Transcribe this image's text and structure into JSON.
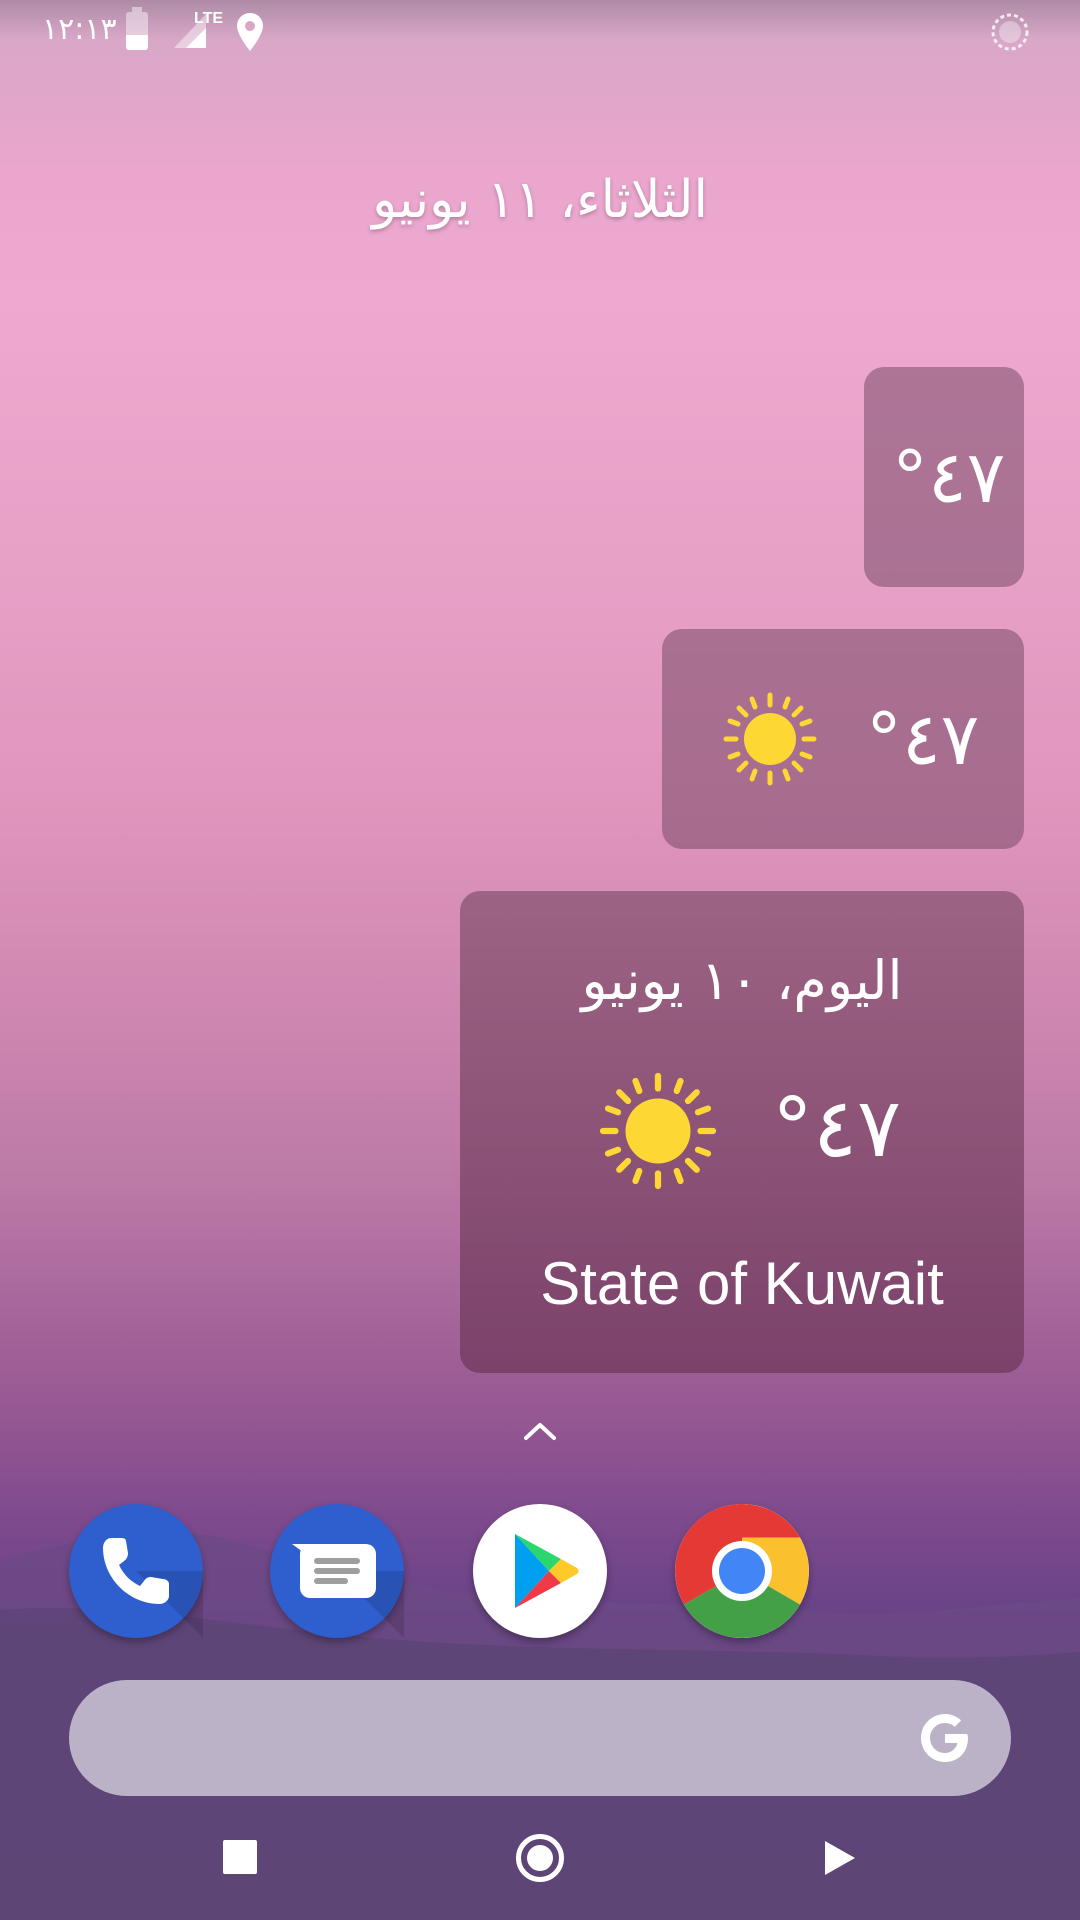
{
  "status_bar": {
    "time": "١٢:١٣",
    "network_label": "LTE",
    "icons": [
      "battery-icon",
      "signal-icon",
      "location-icon",
      "sync-icon"
    ]
  },
  "home": {
    "date": "الثلاثاء، ١١ يونيو"
  },
  "widgets": {
    "small": {
      "temperature": "°٤٧"
    },
    "medium": {
      "temperature": "°٤٧",
      "icon": "sun-icon"
    },
    "large": {
      "date": "اليوم، ١٠ يونيو",
      "temperature": "°٤٧",
      "icon": "sun-icon",
      "location": "State of Kuwait"
    }
  },
  "dock": {
    "apps": [
      "phone",
      "messages",
      "play-store",
      "chrome"
    ]
  },
  "search": {
    "icon": "google-icon"
  },
  "navigation": {
    "buttons": [
      "recent-apps",
      "home",
      "back"
    ]
  },
  "colors": {
    "sun": "#fdd835",
    "widget_bg": "#734664",
    "dock_blue": "#2f5ecf"
  }
}
